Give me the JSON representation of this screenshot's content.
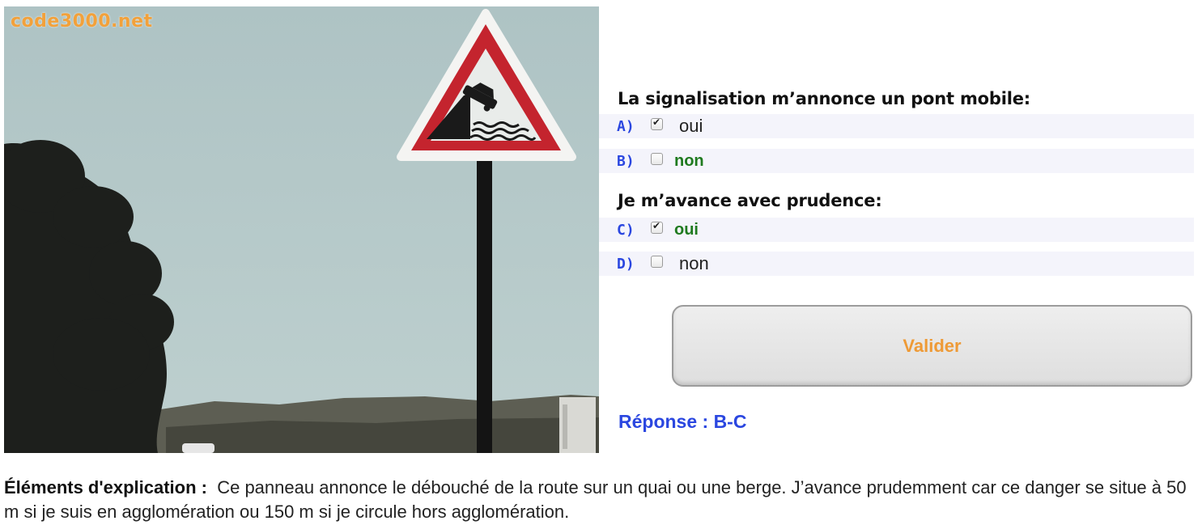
{
  "watermark": "code3000.net",
  "photo": {
    "subject": "warning-sign-quay-riverbank",
    "sky_color": "#b5c8c9",
    "sign_border_color": "#c4242e"
  },
  "questions": [
    {
      "text": "La signalisation m’annonce un pont mobile:",
      "options": [
        {
          "letter": "A)",
          "label": "oui",
          "checked": true,
          "correct": false
        },
        {
          "letter": "B)",
          "label": "non",
          "checked": false,
          "correct": true
        }
      ]
    },
    {
      "text": "Je m’avance avec prudence:",
      "options": [
        {
          "letter": "C)",
          "label": "oui",
          "checked": true,
          "correct": true
        },
        {
          "letter": "D)",
          "label": "non",
          "checked": false,
          "correct": false
        }
      ]
    }
  ],
  "validate_label": "Valider",
  "answer": "Réponse : B-C",
  "explanation": {
    "lead": "Éléments d'explication :",
    "text": "Ce panneau annonce le débouché de la route sur un quai ou une berge. J’avance prudemment car ce danger se situe à 50 m si je suis en agglomération ou 150 m si je circule hors agglomération."
  },
  "colors": {
    "letter": "#2b47e0",
    "correct": "#1f7a1f",
    "validate_text": "#ee9a36",
    "answer": "#2b47e0",
    "watermark": "#f2a13b"
  }
}
